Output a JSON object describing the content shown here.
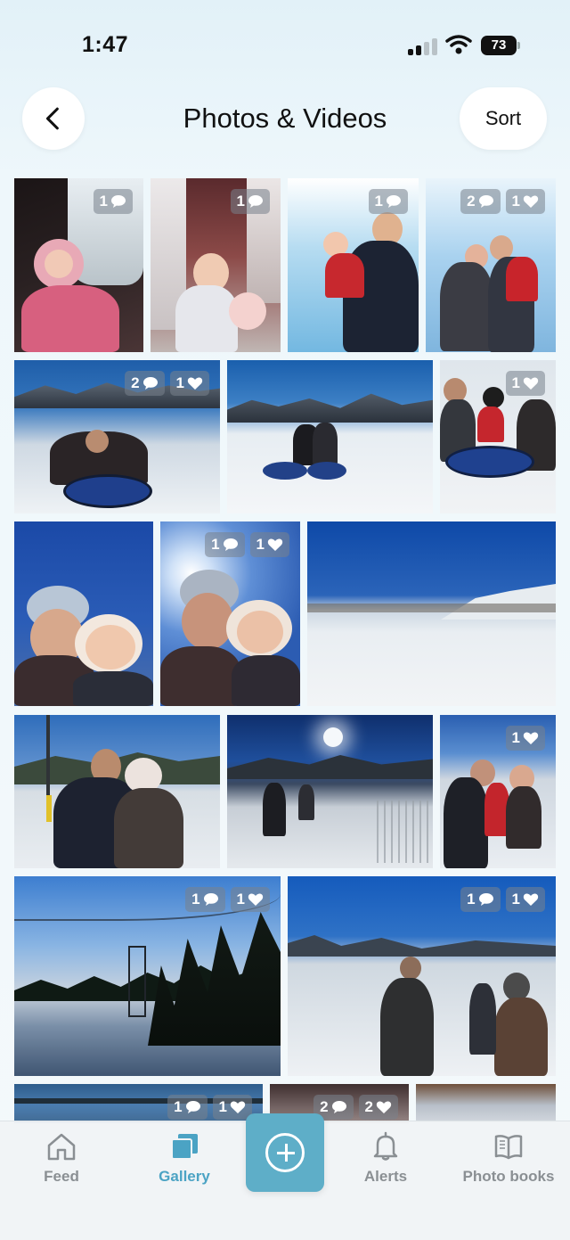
{
  "status_bar": {
    "time": "1:47",
    "battery": "73"
  },
  "header": {
    "title": "Photos & Videos",
    "sort_label": "Sort"
  },
  "tiles": [
    {
      "comments": "1",
      "likes": ""
    },
    {
      "comments": "1",
      "likes": ""
    },
    {
      "comments": "1",
      "likes": ""
    },
    {
      "comments": "2",
      "likes": "1"
    },
    {
      "comments": "2",
      "likes": "1"
    },
    {
      "comments": "",
      "likes": ""
    },
    {
      "comments": "",
      "likes": "1"
    },
    {
      "comments": "",
      "likes": ""
    },
    {
      "comments": "1",
      "likes": "1"
    },
    {
      "comments": "",
      "likes": ""
    },
    {
      "comments": "",
      "likes": ""
    },
    {
      "comments": "",
      "likes": ""
    },
    {
      "comments": "",
      "likes": "1"
    },
    {
      "comments": "1",
      "likes": "1"
    },
    {
      "comments": "1",
      "likes": "1"
    },
    {
      "comments": "1",
      "likes": "1"
    },
    {
      "comments": "2",
      "likes": "2"
    },
    {
      "comments": "",
      "likes": ""
    }
  ],
  "nav": {
    "feed": "Feed",
    "gallery": "Gallery",
    "alerts": "Alerts",
    "photo_books": "Photo books"
  },
  "colors": {
    "accent": "#5eaec8",
    "active_label": "#4ba3c4",
    "inactive": "#8a8f93"
  },
  "icons": [
    "back-chevron-icon",
    "comment-icon",
    "heart-icon",
    "home-icon",
    "gallery-icon",
    "plus-icon",
    "bell-icon",
    "book-icon"
  ]
}
